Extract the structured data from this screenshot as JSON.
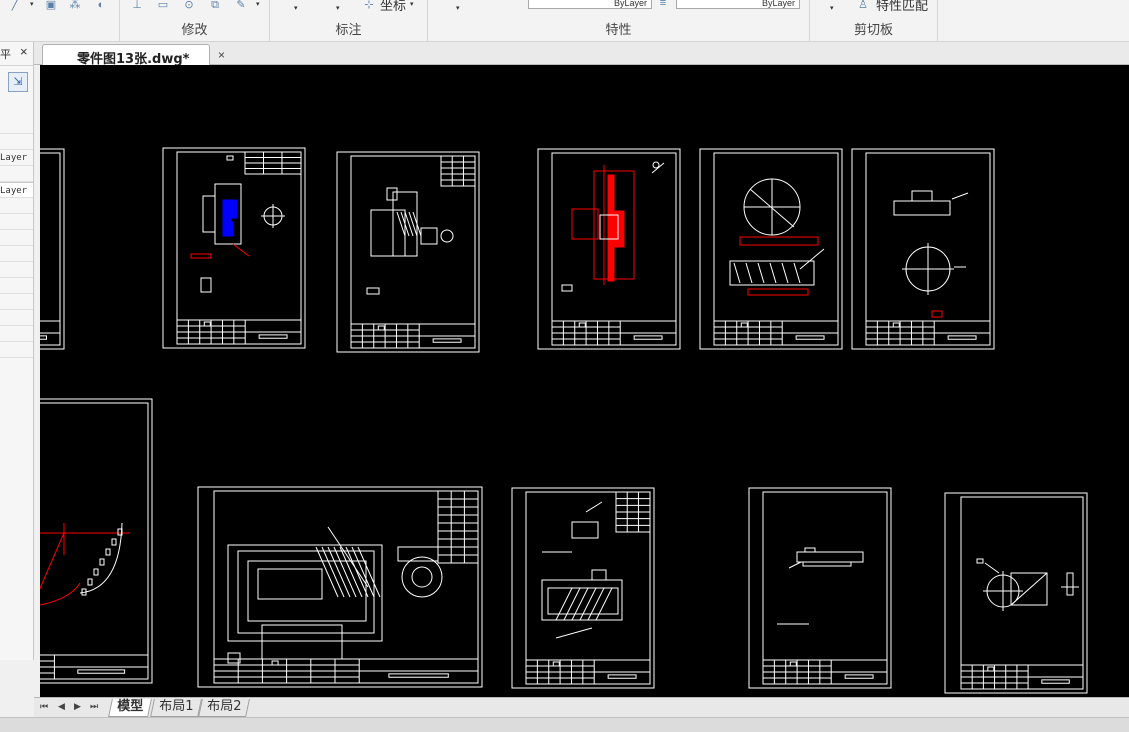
{
  "ribbon": {
    "groups": [
      {
        "label": "修改"
      },
      {
        "label": "标注"
      },
      {
        "label": "特性"
      },
      {
        "label": "剪切板"
      }
    ],
    "coordinate_label": "坐标",
    "match_props_label": "特性匹配",
    "linetype_value": "ByLayer",
    "lineweight_value": "ByLayer"
  },
  "palette": {
    "pin_glyph": "平",
    "close_glyph": "×",
    "rows": [
      "",
      "",
      "Layer",
      "",
      "Layer",
      "",
      "",
      "",
      "",
      "",
      "",
      "",
      "",
      "",
      ""
    ]
  },
  "document": {
    "tab_title": "零件图13张.dwg*",
    "close_glyph": "×"
  },
  "layouts": {
    "tabs": [
      "模型",
      "布局1",
      "布局2"
    ],
    "active": "模型",
    "nav": [
      "⏮",
      "◀",
      "▶",
      "⏭"
    ]
  },
  "colors": {
    "canvas_bg": "#000000",
    "line": "#ffffff",
    "accent_red": "#ff0000",
    "accent_blue": "#0000ff"
  }
}
